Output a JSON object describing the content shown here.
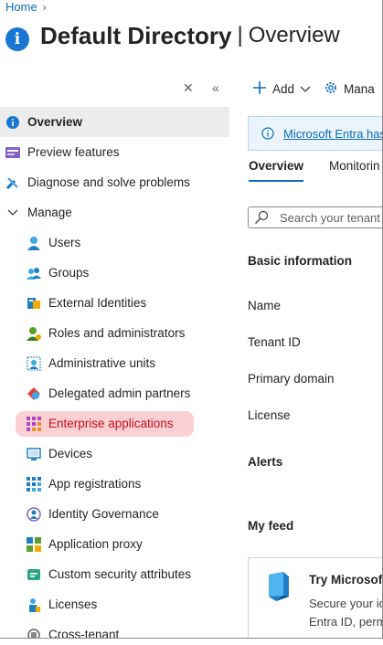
{
  "breadcrumb": {
    "home": "Home"
  },
  "header": {
    "title": "Default Directory",
    "separator": "|",
    "subtitle": "Overview"
  },
  "sidebar": {
    "items": [
      {
        "label": "Overview",
        "icon": "info-icon"
      },
      {
        "label": "Preview features",
        "icon": "preview-features-icon"
      },
      {
        "label": "Diagnose and solve problems",
        "icon": "wrench-icon"
      },
      {
        "label": "Manage",
        "icon": "chevron-down-icon"
      },
      {
        "label": "Users",
        "icon": "user-icon"
      },
      {
        "label": "Groups",
        "icon": "groups-icon"
      },
      {
        "label": "External Identities",
        "icon": "external-identities-icon"
      },
      {
        "label": "Roles and administrators",
        "icon": "roles-icon"
      },
      {
        "label": "Administrative units",
        "icon": "admin-units-icon"
      },
      {
        "label": "Delegated admin partners",
        "icon": "delegated-admin-icon"
      },
      {
        "label": "Enterprise applications",
        "icon": "enterprise-apps-icon"
      },
      {
        "label": "Devices",
        "icon": "devices-icon"
      },
      {
        "label": "App registrations",
        "icon": "app-registrations-icon"
      },
      {
        "label": "Identity Governance",
        "icon": "identity-governance-icon"
      },
      {
        "label": "Application proxy",
        "icon": "application-proxy-icon"
      },
      {
        "label": "Custom security attributes",
        "icon": "custom-security-icon"
      },
      {
        "label": "Licenses",
        "icon": "licenses-icon"
      },
      {
        "label": "Cross-tenant",
        "icon": "cross-tenant-icon"
      }
    ]
  },
  "toolbar": {
    "add": "Add",
    "manage": "Mana"
  },
  "banner": {
    "link": "Microsoft Entra has"
  },
  "tabs": [
    "Overview",
    "Monitorin"
  ],
  "search": {
    "placeholder": "Search your tenant"
  },
  "main": {
    "basic_info": "Basic information",
    "name": "Name",
    "tenant_id": "Tenant ID",
    "primary_domain": "Primary domain",
    "license": "License",
    "alerts": "Alerts",
    "my_feed": "My feed"
  },
  "feed_card": {
    "title": "Try Microsoft",
    "line1": "Secure your id",
    "line2": "Entra ID, perm"
  },
  "colors": {
    "accent": "#0f6cbd",
    "active_bg": "#fbd0d3",
    "active_text": "#c50f1f",
    "selected_bg": "#ececec"
  }
}
